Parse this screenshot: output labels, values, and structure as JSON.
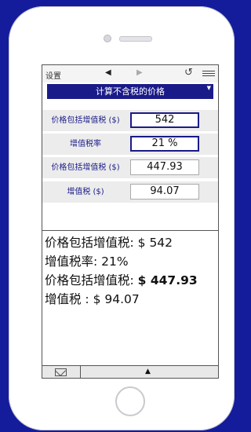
{
  "toolbar": {
    "settings_label": "设置",
    "prev_icon": "◀",
    "next_icon": "▶",
    "undo_icon": "↺"
  },
  "title": "计算不含税的价格",
  "title_caret": "▼",
  "rows": [
    {
      "label": "价格包括增值税 ($)",
      "value": "542",
      "active": true
    },
    {
      "label": "增值税率",
      "value": "21 %",
      "active": true
    },
    {
      "label": "价格包括增值税 ($)",
      "value": "447.93",
      "active": false
    },
    {
      "label": "增值税 ($)",
      "value": "94.07",
      "active": false
    }
  ],
  "results": {
    "line1": "价格包括增值税: $ 542",
    "line2": "增值税率: 21%",
    "line3_prefix": "价格包括增值税: ",
    "line3_value": "$ 447.93",
    "line4": "增值税 : $ 94.07"
  },
  "bottombar": {
    "up_icon": "▲"
  },
  "colors": {
    "background": "#141c9c",
    "accent": "#1a1b88"
  }
}
